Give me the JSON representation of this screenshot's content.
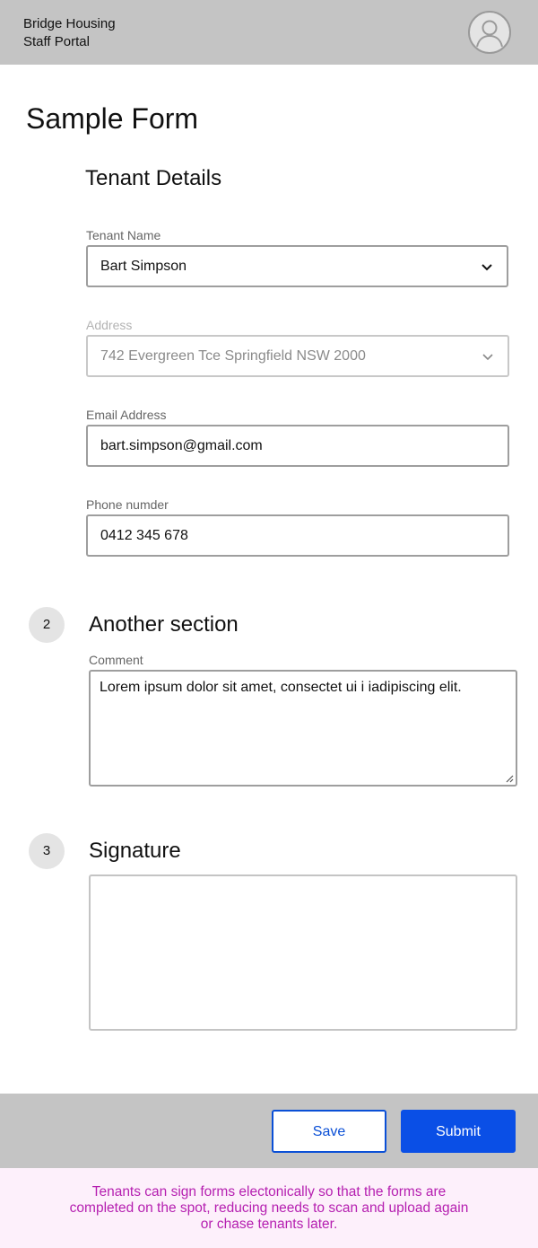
{
  "header": {
    "brand_line1": "Bridge Housing",
    "brand_line2": "Staff Portal",
    "avatar_icon": "user-avatar-icon"
  },
  "page": {
    "title": "Sample Form"
  },
  "section1": {
    "title": "Tenant Details",
    "tenant_name": {
      "label": "Tenant Name",
      "value": "Bart Simpson"
    },
    "address": {
      "label": "Address",
      "value": "742 Evergreen Tce Springfield NSW 2000",
      "disabled": true
    },
    "email": {
      "label": "Email Address",
      "value": "bart.simpson@gmail.com"
    },
    "phone": {
      "label": "Phone numder",
      "value": "0412 345 678"
    }
  },
  "section2": {
    "step": "2",
    "title": "Another section",
    "comment": {
      "label": "Comment",
      "value": "Lorem ipsum dolor sit amet, consectet ui i iadipiscing elit."
    }
  },
  "section3": {
    "step": "3",
    "title": "Signature"
  },
  "footer": {
    "save_label": "Save",
    "submit_label": "Submit"
  },
  "note": {
    "text": "Tenants can sign forms electonically so that the forms are completed on the spot, reducing needs to scan and upload again or chase tenants later."
  },
  "colors": {
    "header_bg": "#c4c4c4",
    "primary": "#0a4fe6",
    "note_text": "#b51fb0",
    "note_bg": "#fdf0fb"
  }
}
